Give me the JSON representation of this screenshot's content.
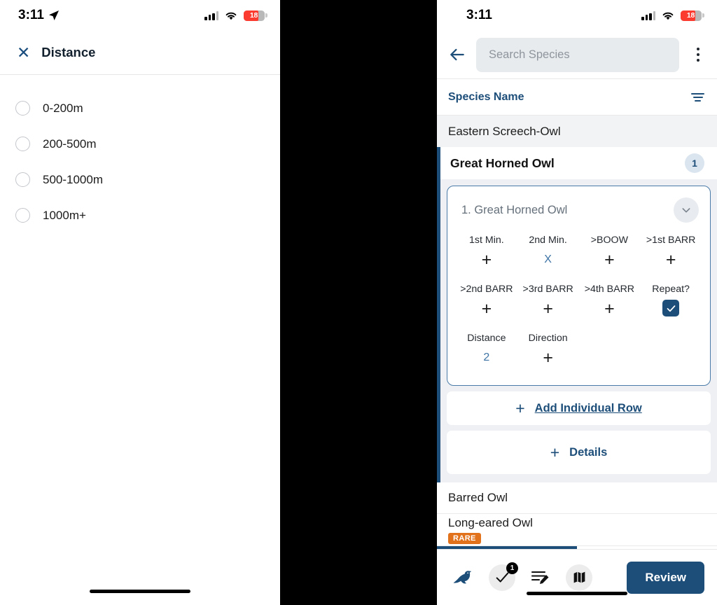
{
  "left_panel": {
    "status_bar": {
      "time": "3:11",
      "location_icon": "location-arrow-icon",
      "signal_icon": "cellular-signal-icon",
      "wifi_icon": "wifi-icon",
      "battery_level": "18"
    },
    "header": {
      "close_icon": "close-x-icon",
      "title": "Distance"
    },
    "options": [
      {
        "label": "0-200m",
        "selected": false
      },
      {
        "label": "200-500m",
        "selected": false
      },
      {
        "label": "500-1000m",
        "selected": false
      },
      {
        "label": "1000m+",
        "selected": false
      }
    ]
  },
  "right_panel": {
    "status_bar": {
      "time": "3:11",
      "signal_icon": "cellular-signal-icon",
      "wifi_icon": "wifi-icon",
      "battery_level": "18"
    },
    "search": {
      "back_icon": "back-arrow-icon",
      "placeholder": "Search Species",
      "value": "",
      "menu_icon": "kebab-menu-icon"
    },
    "list_header": {
      "title": "Species Name",
      "filter_icon": "filter-icon"
    },
    "species_before": [
      {
        "label": "Eastern Screech-Owl"
      }
    ],
    "selected_species": {
      "name": "Great Horned Owl",
      "count": "1",
      "individual_row": {
        "title": "1. Great Horned Owl",
        "collapse_icon": "chevron-down-icon",
        "fields": [
          {
            "label": "1st Min.",
            "value": "+",
            "type": "plus"
          },
          {
            "label": "2nd Min.",
            "value": "X",
            "type": "blue"
          },
          {
            "label": ">BOOW",
            "value": "+",
            "type": "plus"
          },
          {
            "label": ">1st BARR",
            "value": "+",
            "type": "plus"
          },
          {
            "label": ">2nd BARR",
            "value": "+",
            "type": "plus"
          },
          {
            "label": ">3rd BARR",
            "value": "+",
            "type": "plus"
          },
          {
            "label": ">4th BARR",
            "value": "+",
            "type": "plus"
          },
          {
            "label": "Repeat?",
            "value": "",
            "type": "checkbox",
            "checked": true
          },
          {
            "label": "Distance",
            "value": "2",
            "type": "blue"
          },
          {
            "label": "Direction",
            "value": "+",
            "type": "plus"
          }
        ]
      },
      "add_row_button": {
        "icon": "plus-icon",
        "label": "Add Individual Row"
      },
      "details_button": {
        "icon": "plus-icon",
        "label": "Details"
      }
    },
    "species_after": [
      {
        "label": "Barred Owl",
        "badge": ""
      },
      {
        "label": "Long-eared Owl",
        "badge": "RARE"
      }
    ],
    "bottom_nav": {
      "items": [
        {
          "icon": "bird-icon",
          "name": "species-tab",
          "badge": ""
        },
        {
          "icon": "checkmark-icon",
          "name": "checklist-tab",
          "badge": "1"
        },
        {
          "icon": "notes-edit-icon",
          "name": "notes-tab",
          "badge": ""
        },
        {
          "icon": "map-icon",
          "name": "map-tab",
          "badge": ""
        }
      ],
      "review_label": "Review"
    }
  },
  "colors": {
    "brand_blue": "#1d4e79",
    "accent_blue": "#3d73a5",
    "rare_orange": "#e2711b",
    "battery_red": "#fb3b30"
  }
}
